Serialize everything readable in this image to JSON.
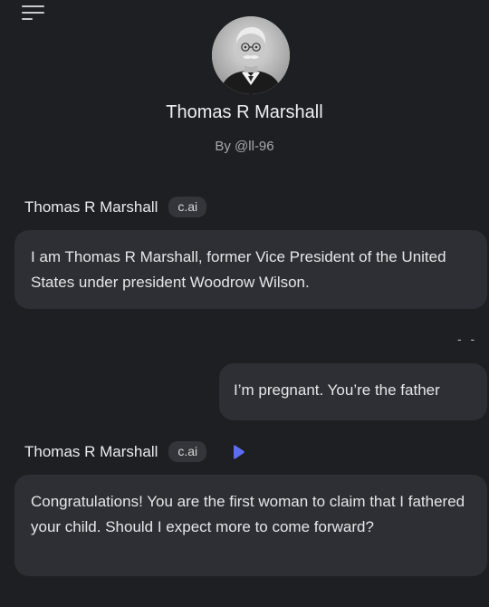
{
  "header": {
    "menu_icon": "hamburger-menu-icon",
    "character_name": "Thomas R Marshall",
    "creator": "By @ll-96"
  },
  "messages": [
    {
      "sender": "Thomas R Marshall",
      "badge": "c.ai",
      "text": "I am Thomas R Marshall, former Vice President of the United States under president Woodrow Wilson."
    },
    {
      "indicator": "- -",
      "text": "I’m pregnant. You’re the father"
    },
    {
      "sender": "Thomas R Marshall",
      "badge": "c.ai",
      "play_icon": "play-icon",
      "text": "Congratulations!  You are the first woman to claim that I fathered your child.  Should I expect more to come forward?"
    }
  ],
  "colors": {
    "background": "#1e1f22",
    "bubble": "#2e2f34",
    "badge": "#34353a",
    "accent": "#5b6cf5"
  }
}
